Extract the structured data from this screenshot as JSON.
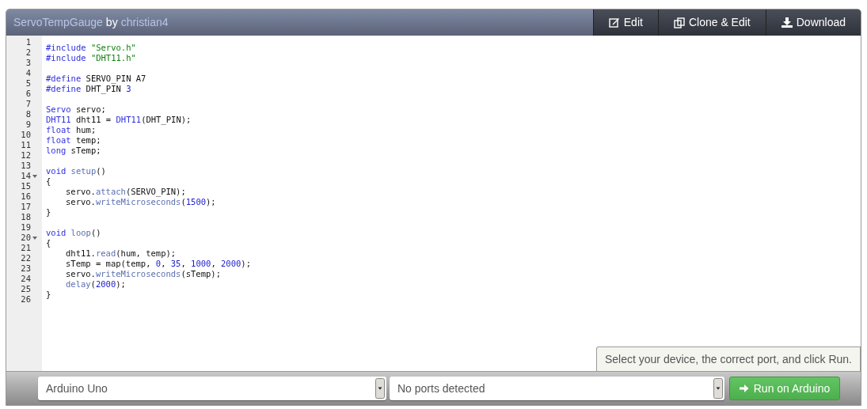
{
  "header": {
    "title": "ServoTempGauge",
    "by": "by",
    "author": "christian4",
    "buttons": [
      {
        "kind": "edit",
        "label": "Edit"
      },
      {
        "kind": "clone",
        "label": "Clone & Edit"
      },
      {
        "kind": "download",
        "label": "Download"
      }
    ]
  },
  "code_lines": [
    {
      "number": "1",
      "fold": false,
      "indent": false,
      "tokens": [
        {
          "kind": "keyword",
          "text": "#include "
        },
        {
          "kind": "string",
          "text": "\"Servo.h\""
        }
      ]
    },
    {
      "number": "2",
      "fold": false,
      "indent": false,
      "tokens": [
        {
          "kind": "keyword",
          "text": "#include "
        },
        {
          "kind": "string",
          "text": "\"DHT11.h\""
        }
      ]
    },
    {
      "number": "3",
      "fold": false,
      "indent": false
    },
    {
      "number": "4",
      "fold": false,
      "indent": false,
      "tokens": [
        {
          "kind": "keyword",
          "text": "#define"
        },
        {
          "kind": "plain",
          "text": " SERVO_PIN A7"
        }
      ]
    },
    {
      "number": "5",
      "fold": false,
      "indent": false,
      "tokens": [
        {
          "kind": "keyword",
          "text": "#define"
        },
        {
          "kind": "plain",
          "text": " DHT_PIN "
        },
        {
          "kind": "number",
          "text": "3"
        }
      ]
    },
    {
      "number": "6",
      "fold": false,
      "indent": false
    },
    {
      "number": "7",
      "fold": false,
      "indent": false,
      "tokens": [
        {
          "kind": "keyword",
          "text": "Servo"
        },
        {
          "kind": "plain",
          "text": " servo;"
        }
      ]
    },
    {
      "number": "8",
      "fold": false,
      "indent": false,
      "tokens": [
        {
          "kind": "keyword",
          "text": "DHT11"
        },
        {
          "kind": "plain",
          "text": " dht11 = "
        },
        {
          "kind": "keyword",
          "text": "DHT11"
        },
        {
          "kind": "plain",
          "text": "(DHT_PIN);"
        }
      ]
    },
    {
      "number": "9",
      "fold": false,
      "indent": false,
      "tokens": [
        {
          "kind": "keyword",
          "text": "float"
        },
        {
          "kind": "plain",
          "text": " hum;"
        }
      ]
    },
    {
      "number": "10",
      "fold": false,
      "indent": false,
      "tokens": [
        {
          "kind": "keyword",
          "text": "float"
        },
        {
          "kind": "plain",
          "text": " temp;"
        }
      ]
    },
    {
      "number": "11",
      "fold": false,
      "indent": false,
      "tokens": [
        {
          "kind": "keyword",
          "text": "long"
        },
        {
          "kind": "plain",
          "text": " sTemp;"
        }
      ]
    },
    {
      "number": "12",
      "fold": false,
      "indent": false
    },
    {
      "number": "13",
      "fold": false,
      "indent": false,
      "tokens": [
        {
          "kind": "keyword",
          "text": "void "
        },
        {
          "kind": "function",
          "text": "setup"
        },
        {
          "kind": "plain",
          "text": "()"
        }
      ]
    },
    {
      "number": "14",
      "fold": true,
      "indent": false,
      "tokens": [
        {
          "kind": "plain",
          "text": "{"
        }
      ]
    },
    {
      "number": "15",
      "fold": false,
      "indent": true,
      "tokens": [
        {
          "kind": "plain",
          "text": "servo."
        },
        {
          "kind": "function",
          "text": "attach"
        },
        {
          "kind": "plain",
          "text": "(SERVO_PIN);"
        }
      ]
    },
    {
      "number": "16",
      "fold": false,
      "indent": true,
      "tokens": [
        {
          "kind": "plain",
          "text": "servo."
        },
        {
          "kind": "function",
          "text": "writeMicroseconds"
        },
        {
          "kind": "plain",
          "text": "("
        },
        {
          "kind": "number",
          "text": "1500"
        },
        {
          "kind": "plain",
          "text": ");"
        }
      ]
    },
    {
      "number": "17",
      "fold": false,
      "indent": false,
      "tokens": [
        {
          "kind": "plain",
          "text": "}"
        }
      ]
    },
    {
      "number": "18",
      "fold": false,
      "indent": false
    },
    {
      "number": "19",
      "fold": false,
      "indent": false,
      "tokens": [
        {
          "kind": "keyword",
          "text": "void "
        },
        {
          "kind": "function",
          "text": "loop"
        },
        {
          "kind": "plain",
          "text": "()"
        }
      ]
    },
    {
      "number": "20",
      "fold": true,
      "indent": false,
      "tokens": [
        {
          "kind": "plain",
          "text": "{"
        }
      ]
    },
    {
      "number": "21",
      "fold": false,
      "indent": true,
      "tokens": [
        {
          "kind": "plain",
          "text": "dht11."
        },
        {
          "kind": "function",
          "text": "read"
        },
        {
          "kind": "plain",
          "text": "(hum, temp);"
        }
      ]
    },
    {
      "number": "22",
      "fold": false,
      "indent": true,
      "tokens": [
        {
          "kind": "plain",
          "text": "sTemp = map(temp, "
        },
        {
          "kind": "number",
          "text": "0"
        },
        {
          "kind": "plain",
          "text": ", "
        },
        {
          "kind": "number",
          "text": "35"
        },
        {
          "kind": "plain",
          "text": ", "
        },
        {
          "kind": "number",
          "text": "1000"
        },
        {
          "kind": "plain",
          "text": ", "
        },
        {
          "kind": "number",
          "text": "2000"
        },
        {
          "kind": "plain",
          "text": ");"
        }
      ]
    },
    {
      "number": "23",
      "fold": false,
      "indent": true,
      "tokens": [
        {
          "kind": "plain",
          "text": "servo."
        },
        {
          "kind": "function",
          "text": "writeMicroseconds"
        },
        {
          "kind": "plain",
          "text": "(sTemp);"
        }
      ]
    },
    {
      "number": "24",
      "fold": false,
      "indent": true,
      "tokens": [
        {
          "kind": "function",
          "text": "delay"
        },
        {
          "kind": "plain",
          "text": "("
        },
        {
          "kind": "number",
          "text": "2000"
        },
        {
          "kind": "plain",
          "text": ");"
        }
      ]
    },
    {
      "number": "25",
      "fold": false,
      "indent": false,
      "tokens": [
        {
          "kind": "plain",
          "text": "}"
        }
      ]
    },
    {
      "number": "26",
      "fold": false,
      "indent": false
    }
  ],
  "tooltip": "Select your device, the correct port, and click Run.",
  "footer": {
    "board_select": "Arduino Uno",
    "port_select": "No ports detected",
    "run_button": "Run on Arduino"
  }
}
